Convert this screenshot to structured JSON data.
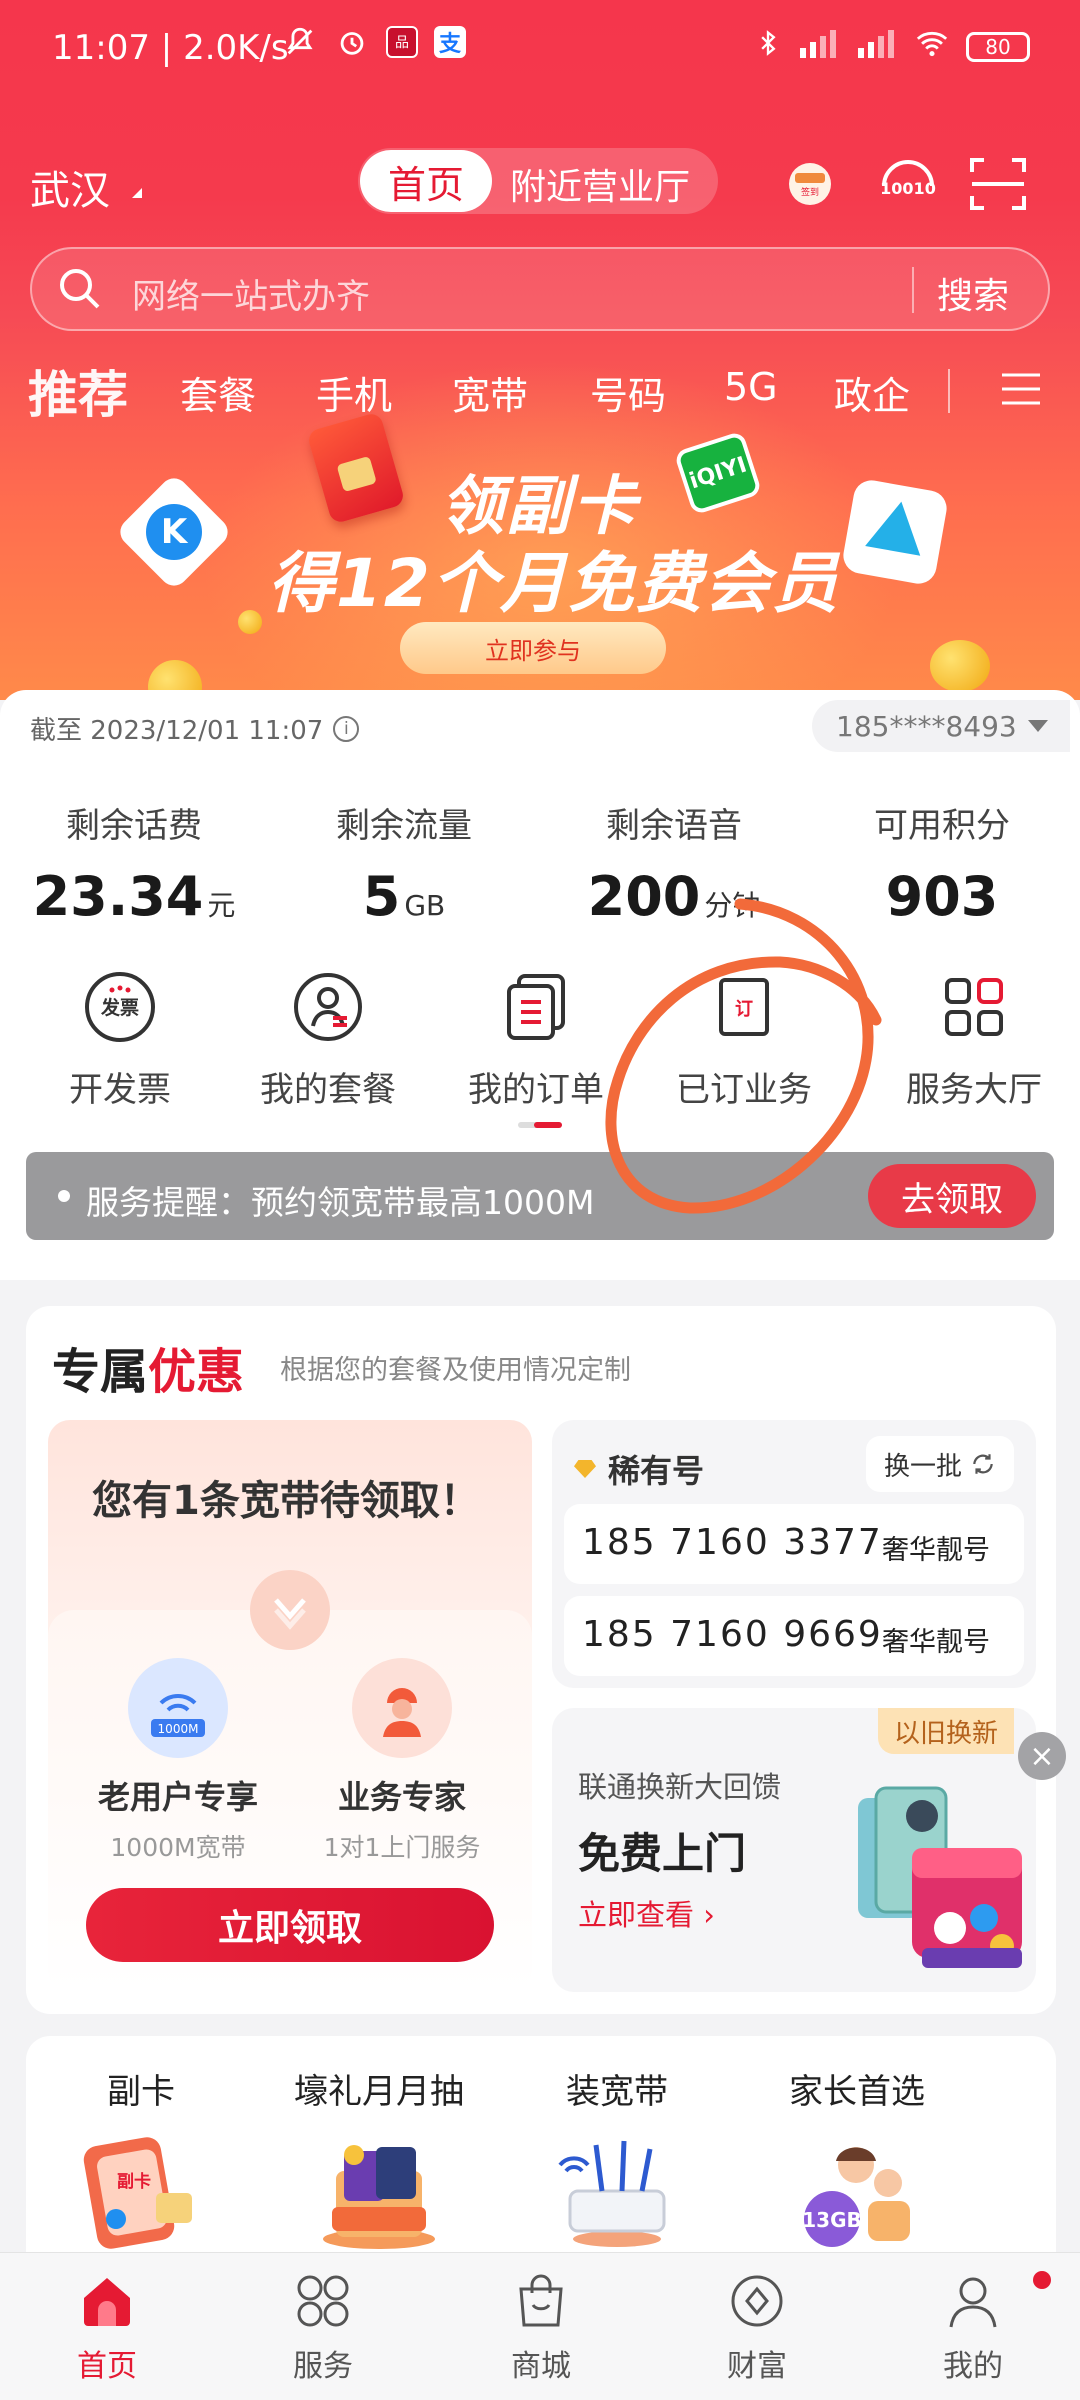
{
  "status_bar": {
    "time": "11:07",
    "net_speed": "2.0K/s",
    "battery": "80",
    "left_icons": [
      "mute-icon",
      "alarm-icon",
      "app-badge-icon",
      "alipay-icon"
    ],
    "right_icons": [
      "bluetooth-icon",
      "signal-hd-icon",
      "signal-hd-icon",
      "wifi-icon"
    ]
  },
  "header": {
    "city": "武汉",
    "tabs": [
      {
        "label": "首页",
        "active": true
      },
      {
        "label": "附近营业厅",
        "active": false
      }
    ],
    "icons": [
      "sign-in-icon",
      "service-10010-icon",
      "scan-icon"
    ],
    "sign_in_label": "签到",
    "service_label": "10010"
  },
  "search": {
    "placeholder": "网络一站式办齐",
    "button": "搜索"
  },
  "categories": [
    "推荐",
    "套餐",
    "手机",
    "宽带",
    "号码",
    "5G",
    "政企"
  ],
  "banner": {
    "line1": "领副卡",
    "line2": "得12个月免费会员",
    "cta": "立即参与",
    "iqiyi": "iQIYI",
    "k_logo": "K"
  },
  "account": {
    "as_of": "截至 2023/12/01 11:07",
    "phone": "185****8493",
    "stats": [
      {
        "label": "剩余话费",
        "value": "23.34",
        "unit": "元"
      },
      {
        "label": "剩余流量",
        "value": "5",
        "unit": "GB"
      },
      {
        "label": "剩余语音",
        "value": "200",
        "unit": "分钟"
      },
      {
        "label": "可用积分",
        "value": "903",
        "unit": ""
      }
    ],
    "quick_actions": [
      {
        "label": "开发票",
        "icon": "invoice-icon",
        "icon_text": "发票"
      },
      {
        "label": "我的套餐",
        "icon": "my-plan-icon",
        "icon_text": ""
      },
      {
        "label": "我的订单",
        "icon": "orders-icon",
        "icon_text": ""
      },
      {
        "label": "已订业务",
        "icon": "subscribed-icon",
        "icon_text": "订"
      },
      {
        "label": "服务大厅",
        "icon": "service-hall-icon",
        "icon_text": ""
      }
    ],
    "notice": {
      "text": "服务提醒：预约领宽带最高1000M",
      "button": "去领取"
    }
  },
  "offers": {
    "title_plain": "专属",
    "title_red": "优惠",
    "subtitle": "根据您的套餐及使用情况定制",
    "broadband": {
      "title": "您有1条宽带待领取！",
      "options": [
        {
          "title": "老用户专享",
          "sub": "1000M宽带",
          "icon": "wifi-1000m-icon",
          "icon_text": "1000M"
        },
        {
          "title": "业务专家",
          "sub": "1对1上门服务",
          "icon": "technician-icon",
          "icon_text": ""
        }
      ],
      "button": "立即领取"
    },
    "rare_numbers": {
      "title": "稀有号",
      "swap": "换一批",
      "items": [
        {
          "number": "185 7160 3377",
          "tag": "奢华靓号"
        },
        {
          "number": "185 7160 9669",
          "tag": "奢华靓号"
        }
      ]
    },
    "trade_in": {
      "badge": "以旧换新",
      "subtitle": "联通换新大回馈",
      "title": "免费上门",
      "link": "立即查看 ›",
      "close": "×"
    }
  },
  "shortcuts": [
    {
      "label": "副卡",
      "icon": "sub-card-icon",
      "icon_text": "副卡"
    },
    {
      "label": "壕礼月月抽",
      "icon": "gift-draw-icon",
      "icon_text": ""
    },
    {
      "label": "装宽带",
      "icon": "router-icon",
      "icon_text": ""
    },
    {
      "label": "家长首选",
      "icon": "family-icon",
      "icon_text": "13GB"
    }
  ],
  "bottom_nav": [
    {
      "label": "首页",
      "icon": "home-icon",
      "active": true
    },
    {
      "label": "服务",
      "icon": "services-icon",
      "active": false
    },
    {
      "label": "商城",
      "icon": "shopping-bag-icon",
      "active": false
    },
    {
      "label": "财富",
      "icon": "wealth-icon",
      "active": false
    },
    {
      "label": "我的",
      "icon": "profile-icon",
      "active": false
    }
  ],
  "colors": {
    "brand_red": "#e51a33",
    "notice_gray": "#9a9a9c",
    "annotation_orange": "#f26a3a"
  }
}
